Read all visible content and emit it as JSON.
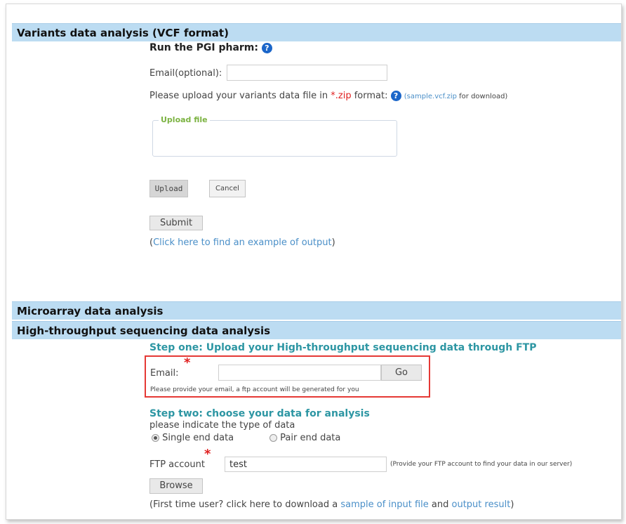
{
  "vcf": {
    "section_title": "Variants data analysis (VCF format)",
    "run_heading": "Run the PGI pharm:",
    "email_label": "Email(optional):",
    "email_value": "",
    "upload_instruction_prefix": "Please upload your variants data file in ",
    "upload_ext": "*.zip",
    "upload_instruction_suffix": " format:",
    "sample_link": "sample.vcf.zip",
    "sample_suffix": " for download)",
    "sample_prefix": "(",
    "upload_legend": "Upload file",
    "upload_button": "Upload",
    "cancel_button": "Cancel",
    "submit_button": "Submit",
    "example_prefix": "(",
    "example_link": "Click here to find an example of output",
    "example_suffix": ")"
  },
  "microarray": {
    "section_title": "Microarray data analysis"
  },
  "hts": {
    "section_title": "High-throughput sequencing data analysis",
    "step_one": "Step one: Upload your High-throughput sequencing data through FTP",
    "required_mark": "*",
    "email_label": "Email:",
    "email_value": "",
    "go_button": "Go",
    "email_hint": "Please provide your email, a ftp account will be generated for you",
    "step_two": "Step two: choose your data for analysis",
    "type_prompt": "please indicate the type of data",
    "radio_single": "Single end data",
    "radio_pair": "Pair end data",
    "radio_selected": "single",
    "ftp_label": "FTP account",
    "ftp_value": "test",
    "ftp_hint": "(Provide your FTP account to find your data in our server)",
    "browse_button": "Browse",
    "footer_prefix": "(First time user? click here to download a ",
    "footer_link1": "sample of input file",
    "footer_mid": " and ",
    "footer_link2": "output result",
    "footer_suffix": ")"
  },
  "colors": {
    "band": "#bcdcf2",
    "link": "#4a8fc8",
    "teal": "#2d96a3",
    "required": "#e02020",
    "highlight_box": "#e53935",
    "legend": "#7cb342"
  },
  "icons": [
    "help-icon"
  ]
}
